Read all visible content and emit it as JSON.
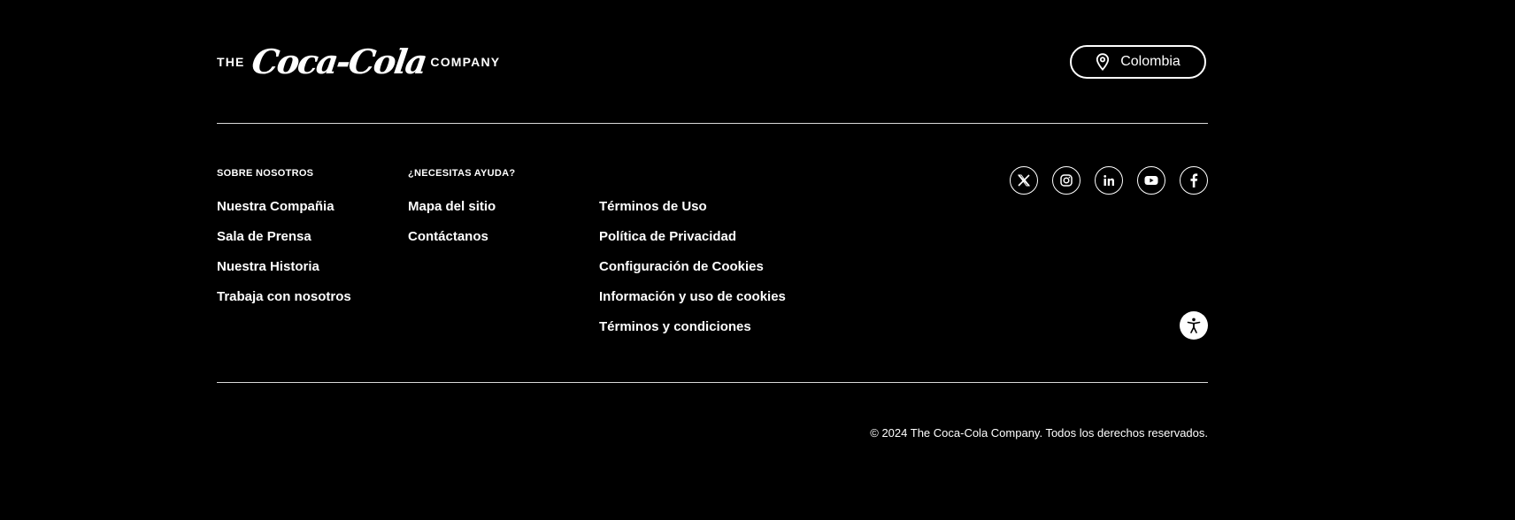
{
  "logo": {
    "the": "THE",
    "script": "Coca-Cola",
    "company": "COMPANY"
  },
  "country_selector": {
    "icon": "location-pin-icon",
    "label": "Colombia"
  },
  "columns": [
    {
      "heading": "SOBRE NOSOTROS",
      "links": [
        "Nuestra Compañia",
        "Sala de Prensa",
        "Nuestra Historia",
        "Trabaja con nosotros"
      ]
    },
    {
      "heading": "¿NECESITAS AYUDA?",
      "links": [
        "Mapa del sitio",
        "Contáctanos"
      ]
    },
    {
      "heading": "",
      "links": [
        "Términos de Uso",
        "Política de Privacidad",
        "Configuración de Cookies",
        "Información y uso de cookies",
        "Términos y condiciones"
      ]
    }
  ],
  "socials": [
    "x-icon",
    "instagram-icon",
    "linkedin-icon",
    "youtube-icon",
    "facebook-icon"
  ],
  "accessibility": {
    "icon": "accessibility-icon"
  },
  "copyright": "© 2024 The Coca-Cola Company. Todos los derechos reservados.",
  "colors": {
    "background": "#000000",
    "text": "#ffffff",
    "divider": "#d8d8d8"
  }
}
